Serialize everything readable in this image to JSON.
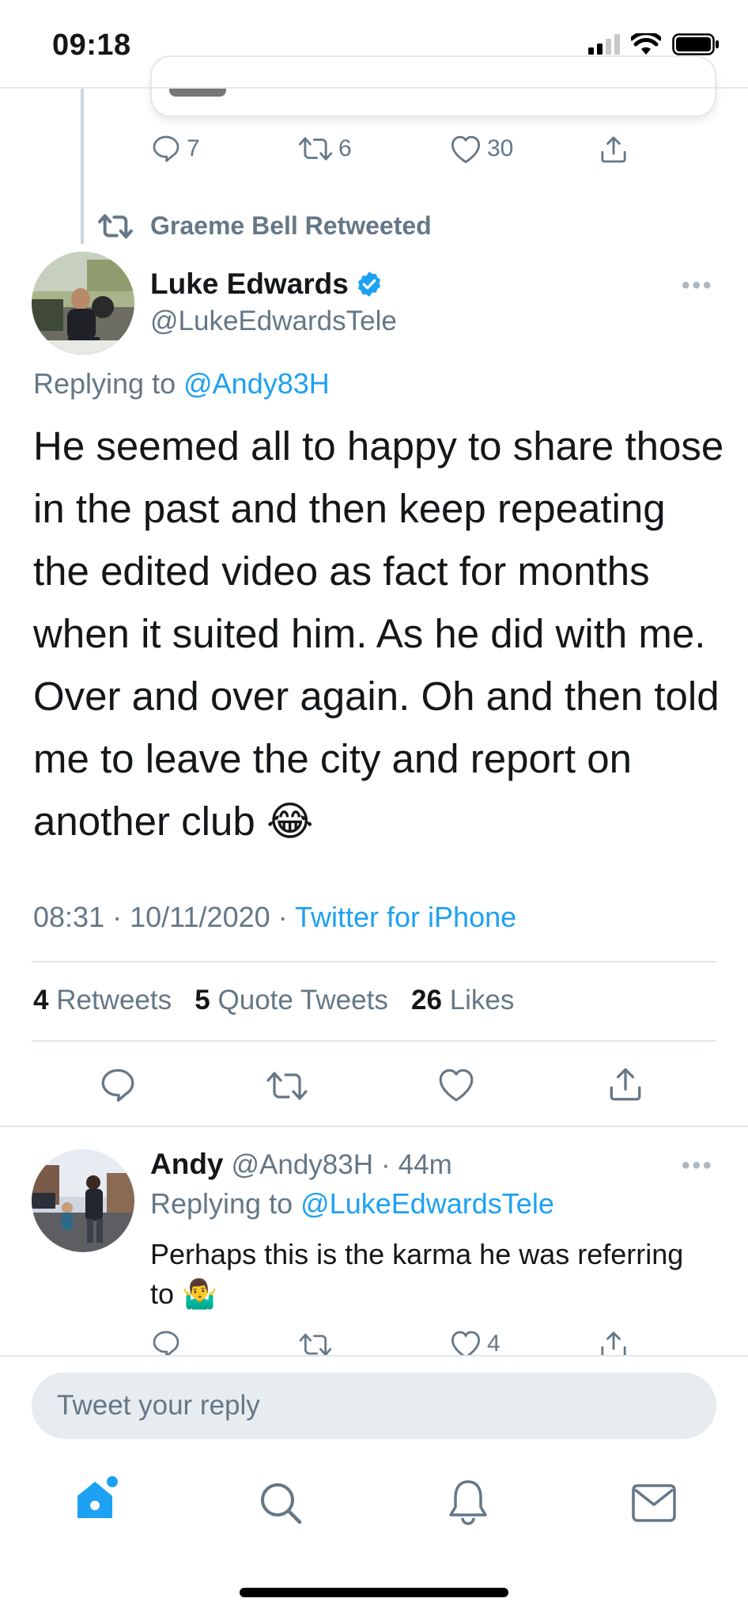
{
  "status_bar": {
    "time": "09:18"
  },
  "previous_tweet": {
    "reply_count": "7",
    "retweet_count": "6",
    "like_count": "30"
  },
  "retweet_context": {
    "label": "Graeme Bell Retweeted"
  },
  "main_tweet": {
    "author_name": "Luke Edwards",
    "author_handle": "@LukeEdwardsTele",
    "verified": true,
    "replying_prefix": "Replying to",
    "replying_to": "@Andy83H",
    "text": "He seemed all to happy to share those in the past and then keep repeating the edited video as fact for months when it suited him. As he did with me. Over and over again. Oh and then told me to leave the city and report on another club 😂",
    "time": "08:31",
    "separator": "·",
    "date": "10/11/2020",
    "source": "Twitter for iPhone",
    "retweets_count": "4",
    "retweets_label": "Retweets",
    "quote_count": "5",
    "quote_label": "Quote Tweets",
    "likes_count": "26",
    "likes_label": "Likes",
    "more": "•••"
  },
  "reply_tweet": {
    "author_name": "Andy",
    "author_handle": "@Andy83H",
    "separator": "·",
    "time_ago": "44m",
    "replying_prefix": "Replying to",
    "replying_to": "@LukeEdwardsTele",
    "text": "Perhaps this is the karma he was referring to 🤷‍♂️",
    "like_count": "4",
    "more": "•••"
  },
  "compose": {
    "placeholder": "Tweet your reply"
  },
  "tab_bar": {
    "items": [
      "home-icon",
      "search-icon",
      "bell-icon",
      "mail-icon"
    ]
  },
  "colors": {
    "accent": "#1da1f2",
    "secondary_text": "#657786",
    "divider": "#e1e8ed",
    "compose_bg": "#e6ecf0"
  }
}
